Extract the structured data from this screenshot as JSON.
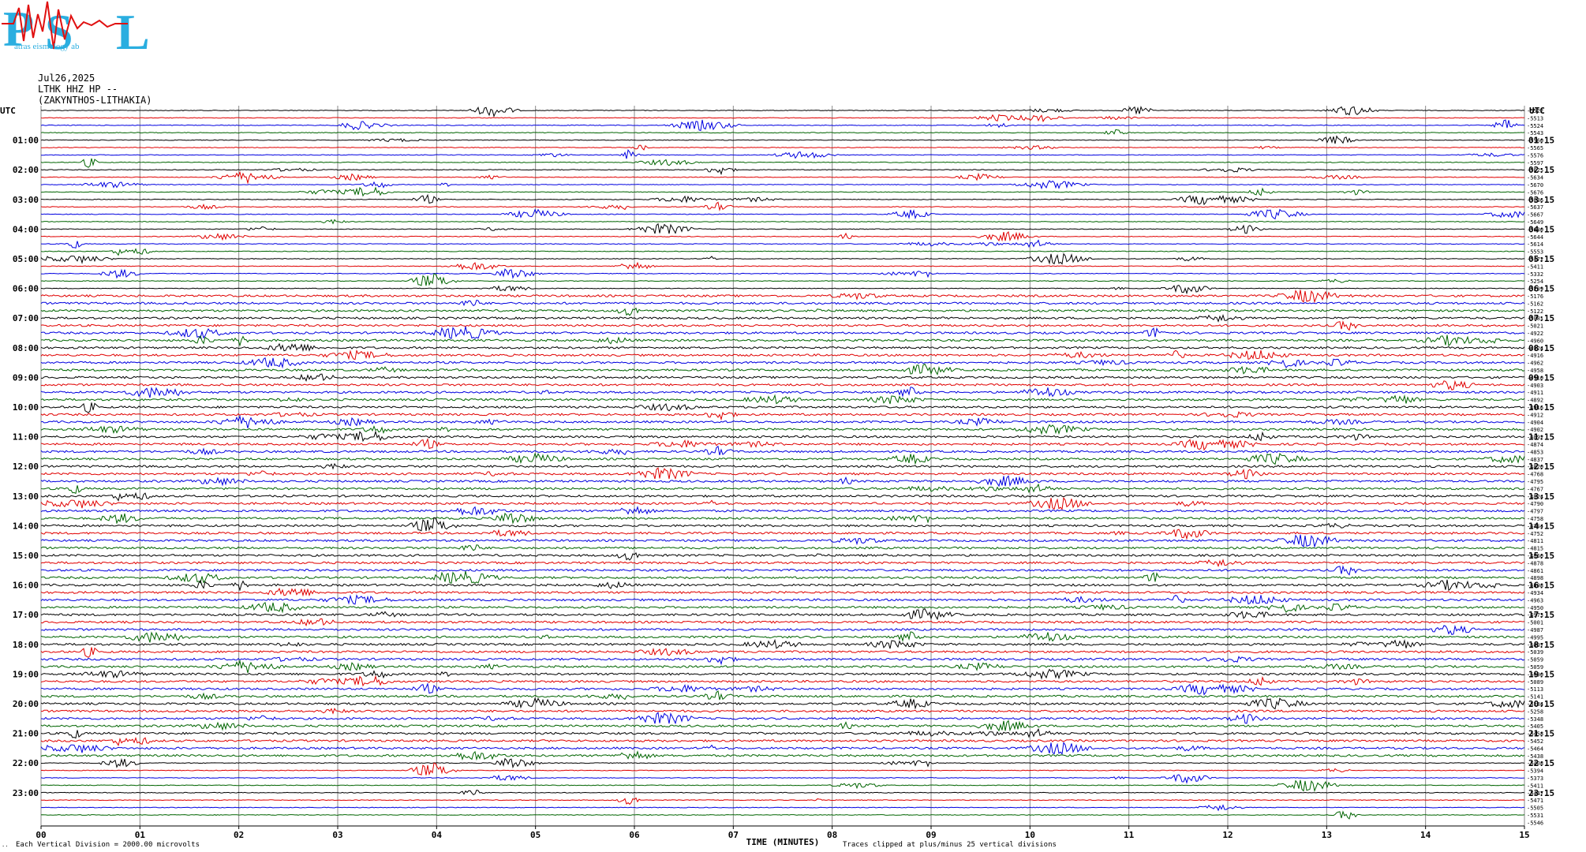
{
  "logo": {
    "letters": [
      "P",
      "S",
      "L"
    ],
    "subtitle": "atras  eismology  ab"
  },
  "header": {
    "date": "Jul26,2025",
    "channel": "LTHK HHZ HP --",
    "station": "(ZAKYNTHOS-LITHAKIA)"
  },
  "footer": {
    "division_note": "Each Vertical Division = 2000.00 microvolts",
    "clip_note": "Traces clipped at plus/minus 25 vertical divisions"
  },
  "colors": {
    "trace_cycle": [
      "#000000",
      "#e00000",
      "#0000e0",
      "#006400"
    ],
    "grid": "#808080"
  },
  "chart_data": {
    "type": "line",
    "subtype": "helicorder",
    "xlabel": "TIME (MINUTES)",
    "x_ticks": [
      "00",
      "01",
      "02",
      "03",
      "04",
      "05",
      "06",
      "07",
      "08",
      "09",
      "10",
      "11",
      "12",
      "13",
      "14",
      "15"
    ],
    "xlim": [
      0,
      15
    ],
    "left_axis_title": "UTC",
    "right_axis_title": "UTC",
    "left_hour_labels": [
      "01:00",
      "02:00",
      "03:00",
      "04:00",
      "05:00",
      "06:00",
      "07:00",
      "08:00",
      "09:00",
      "10:00",
      "11:00",
      "12:00",
      "13:00",
      "14:00",
      "15:00",
      "16:00",
      "17:00",
      "18:00",
      "19:00",
      "20:00",
      "21:00",
      "22:00",
      "23:00"
    ],
    "right_hour_labels": [
      "01:15",
      "02:15",
      "03:15",
      "04:15",
      "05:15",
      "06:15",
      "07:15",
      "08:15",
      "09:15",
      "10:15",
      "11:15",
      "12:15",
      "13:15",
      "14:15",
      "15:15",
      "16:15",
      "17:15",
      "18:15",
      "19:15",
      "20:15",
      "21:15",
      "22:15",
      "23:15"
    ],
    "trace_minutes": 15,
    "trace_count": 96,
    "trace_offsets": [
      "-5522",
      "-5513",
      "-5524",
      "-5543",
      "-5560",
      "-5565",
      "-5576",
      "-5597",
      "-5625",
      "-5634",
      "-5670",
      "-5676",
      "-5636",
      "-5637",
      "-5667",
      "-5649",
      "-5630",
      "-5644",
      "-5614",
      "-5553",
      "-5472",
      "-5411",
      "-5332",
      "-5254",
      "-5209",
      "-5176",
      "-5162",
      "-5122",
      "-5081",
      "-5021",
      "-4922",
      "-4960",
      "-4924",
      "-4916",
      "-4962",
      "-4958",
      "-4910",
      "-4903",
      "-4911",
      "-4892",
      "-4916",
      "-4912",
      "-4904",
      "-4902",
      "-4892",
      "-4874",
      "-4853",
      "-4837",
      "-4820",
      "-4768",
      "-4795",
      "-4767",
      "-4824",
      "-4790",
      "-4797",
      "-4758",
      "-4754",
      "-4752",
      "-4811",
      "-4815",
      "-4860",
      "-4878",
      "-4861",
      "-4898",
      "-4898",
      "-4934",
      "-4963",
      "-4950",
      "-4973",
      "-5001",
      "-4987",
      "-4995",
      "-5007",
      "-5039",
      "-5059",
      "-5059",
      "-5090",
      "-5089",
      "-5113",
      "-5141",
      "-5184",
      "-5258",
      "-5348",
      "-5405",
      "-5458",
      "-5452",
      "-5464",
      "-5438",
      "-5408",
      "-5394",
      "-5373",
      "-5411",
      "-5447",
      "-5471",
      "-5505",
      "-5531",
      "-5546"
    ]
  }
}
